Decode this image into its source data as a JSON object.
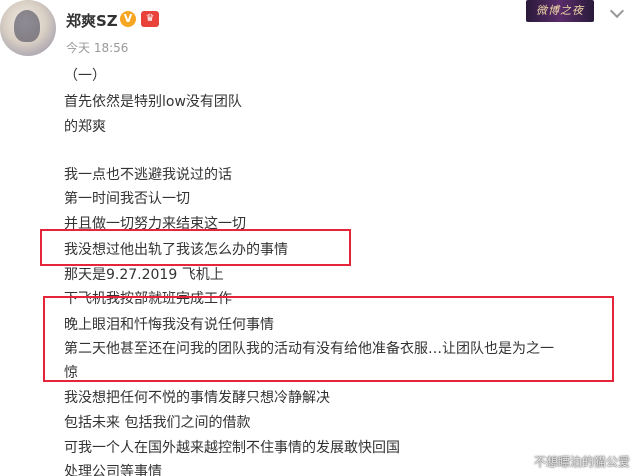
{
  "post": {
    "username": "郑爽SZ",
    "vip_badge": "V",
    "member_badge": "♛",
    "timestamp": "今天 18:56",
    "topic_card": "微博之夜"
  },
  "body_lines": [
    "（一）",
    "首先依然是特别low没有团队",
    "的郑爽",
    "我一点也不逃避我说过的话",
    "第一时间我否认一切",
    "并且做一切努力来结束这一切",
    "我没想过他出轨了我该怎么办的事情",
    "那天是9.27.2019 飞机上",
    "下飞机我按部就班完成工作",
    "晚上眼泪和忏悔我没有说任何事情",
    "第二天他甚至还在问我的团队我的活动有没有给他准备衣服…让团队也是为之一",
    "惊",
    "我没想把任何不悦的事情发酵只想冷静解决",
    "包括未来 包括我们之间的借款",
    "可我一个人在国外越来越控制不住事情的发展敢快回国",
    "处理公司等事情"
  ],
  "watermark": "不想瞟泊的猫公爱",
  "colors": {
    "highlight": "#e5253a",
    "text": "#333333",
    "meta": "#999999"
  }
}
